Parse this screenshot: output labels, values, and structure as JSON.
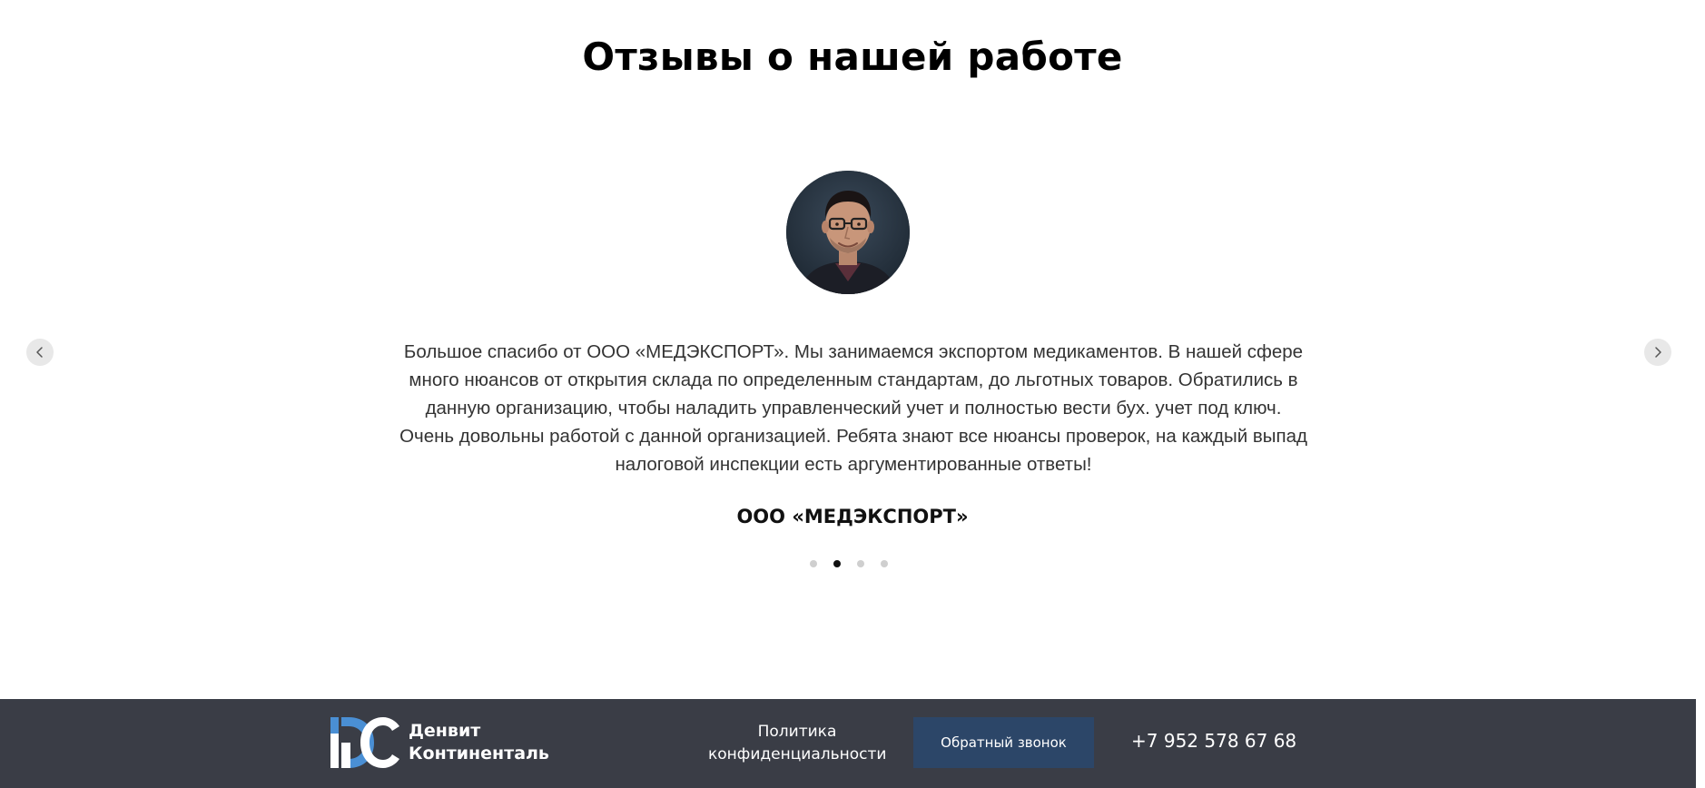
{
  "reviews": {
    "title": "Отзывы о нашей работе",
    "current_review": {
      "text": "Большое спасибо от ООО «МЕДЭКСПОРТ». Мы занимаемся экспортом медикаментов. В нашей сфере много нюансов от открытия склада по определенным стандартам, до льготных товаров. Обратились в данную организацию, чтобы наладить управленческий учет и полностью вести бух. учет под ключ. Очень довольны работой с данной организацией. Ребята знают все нюансы проверок, на каждый выпад налоговой инспекции есть аргументированные ответы!",
      "author": "ООО «МЕДЭКСПОРТ»",
      "avatar": "reviewer-photo"
    },
    "prev_icon": "chevron-left-icon",
    "next_icon": "chevron-right-icon",
    "pagination": {
      "count": 4,
      "active_index": 1
    }
  },
  "footer": {
    "logo": {
      "line1": "Денвит",
      "line2": "Континенталь",
      "icon": "dc-logo-icon"
    },
    "policy": {
      "line1": "Политика",
      "line2": "конфиденциальности"
    },
    "callback_label": "Обратный звонок",
    "phone": "+7 952 578 67 68"
  },
  "colors": {
    "footer_bg": "#3a3d46",
    "button_bg": "#2c4668",
    "logo_accent": "#4a8fd4"
  }
}
